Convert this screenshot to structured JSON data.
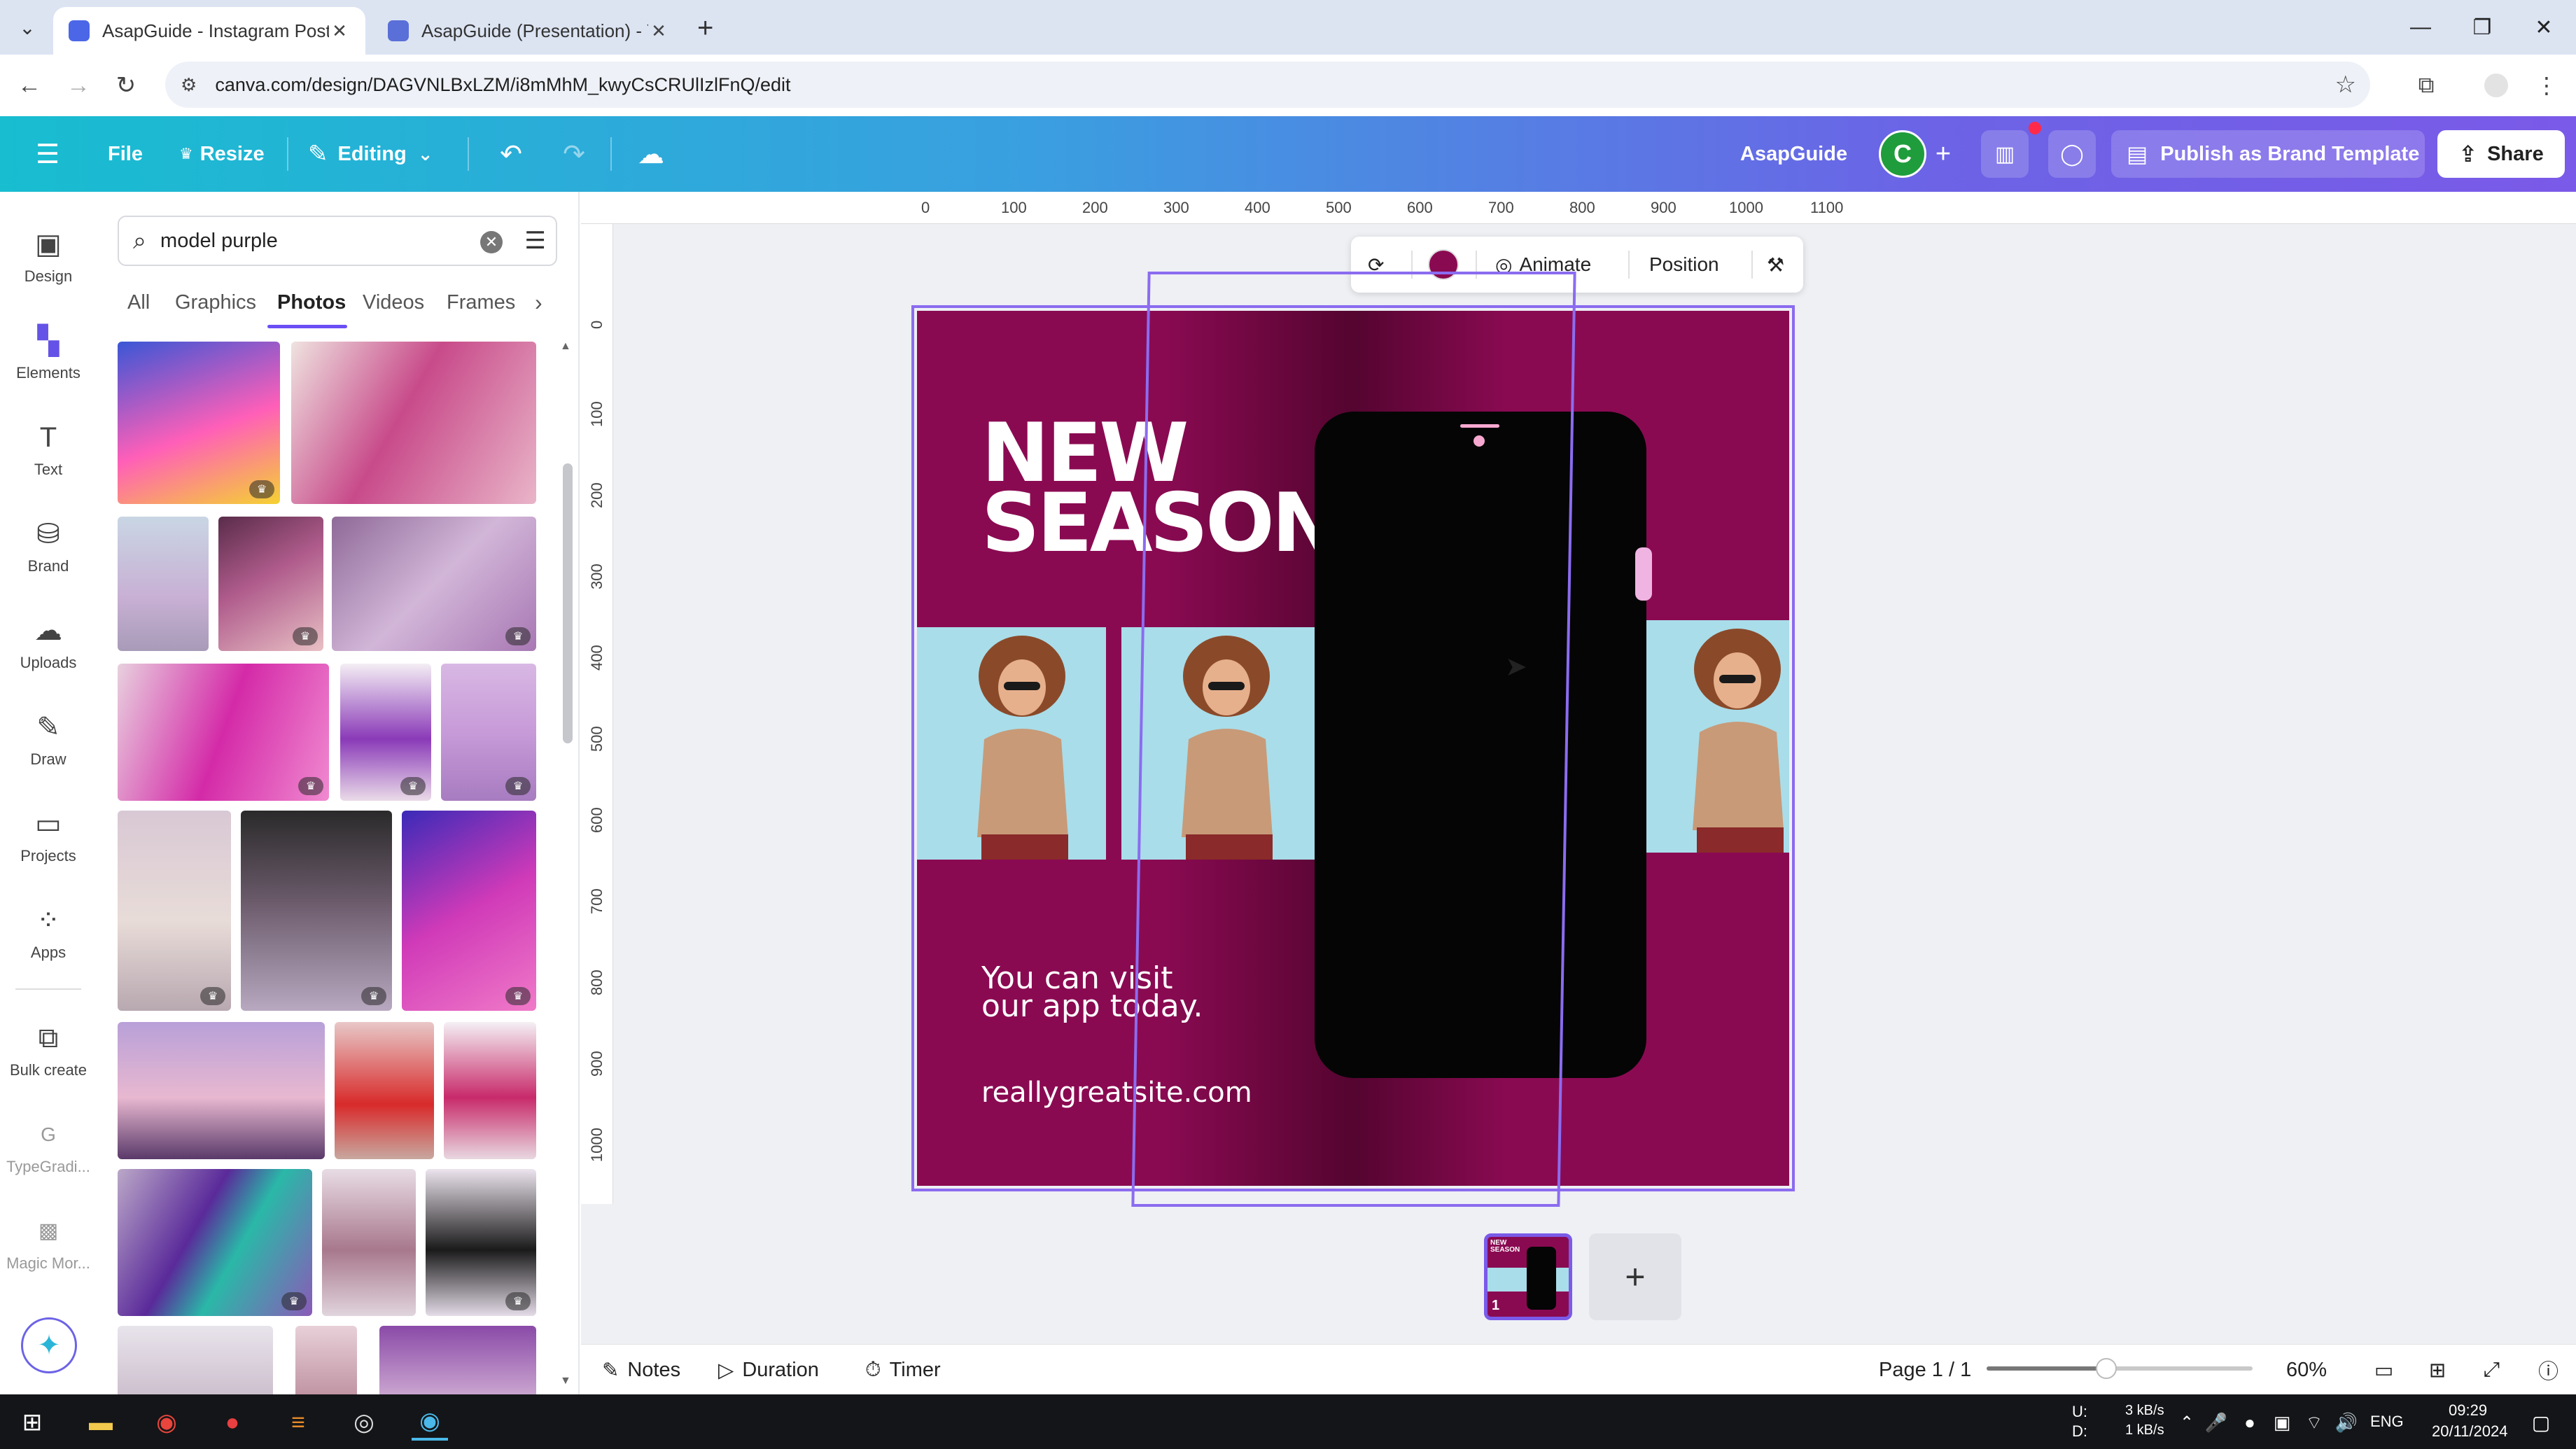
{
  "browser": {
    "tabs": [
      {
        "title": "AsapGuide - Instagram Post",
        "favicon_color": "#4b67e8"
      },
      {
        "title": "AsapGuide (Presentation) - You",
        "favicon_color": "#5b6fd8"
      }
    ],
    "url": "canva.com/design/DAGVNLBxLZM/i8mMhM_kwyCsCRUlIzlFnQ/edit"
  },
  "header": {
    "file": "File",
    "resize": "Resize",
    "editing": "Editing",
    "brand_name": "AsapGuide",
    "avatar_letter": "C",
    "publish": "Publish as Brand Template",
    "share": "Share"
  },
  "rail": {
    "items": [
      {
        "label": "Design",
        "icon": "design-icon"
      },
      {
        "label": "Elements",
        "icon": "elements-icon"
      },
      {
        "label": "Text",
        "icon": "text-icon"
      },
      {
        "label": "Brand",
        "icon": "brand-icon"
      },
      {
        "label": "Uploads",
        "icon": "uploads-icon"
      },
      {
        "label": "Draw",
        "icon": "draw-icon"
      },
      {
        "label": "Projects",
        "icon": "projects-icon"
      },
      {
        "label": "Apps",
        "icon": "apps-icon"
      },
      {
        "label": "Bulk create",
        "icon": "bulk-create-icon"
      },
      {
        "label": "TypeGradi...",
        "icon": "typegradient-icon"
      },
      {
        "label": "Magic Mor...",
        "icon": "magic-morph-icon"
      }
    ]
  },
  "panel": {
    "search_value": "model purple",
    "tabs": [
      "All",
      "Graphics",
      "Photos",
      "Videos",
      "Frames"
    ],
    "active_tab": "Photos"
  },
  "ruler": {
    "top": [
      "0",
      "100",
      "200",
      "300",
      "400",
      "500",
      "600",
      "700",
      "800",
      "900",
      "1000",
      "1100"
    ],
    "left": [
      "0",
      "100",
      "200",
      "300",
      "400",
      "500",
      "600",
      "700",
      "800",
      "900",
      "1000"
    ]
  },
  "floating_toolbar": {
    "animate": "Animate",
    "position": "Position",
    "color": "#8a0a52"
  },
  "design": {
    "headline_1": "NEW",
    "headline_2": "SEASON",
    "visit_1": "You can visit",
    "visit_2": "our app today.",
    "site": "reallygreatsite.com",
    "background": "#8a0a52",
    "page_number": "1"
  },
  "bottom": {
    "notes": "Notes",
    "duration": "Duration",
    "timer": "Timer",
    "page": "Page 1 / 1",
    "zoom": "60%",
    "zoom_percent": 60
  },
  "taskbar": {
    "net_up_label": "U:",
    "net_down_label": "D:",
    "net_up": "3 kB/s",
    "net_down": "1 kB/s",
    "lang": "ENG",
    "time": "09:29",
    "date": "20/11/2024"
  }
}
